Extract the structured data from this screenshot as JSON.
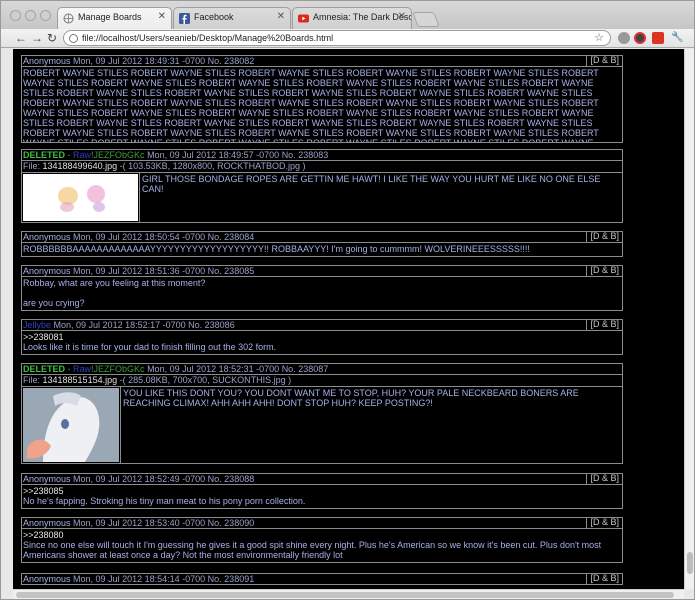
{
  "browser": {
    "tabs": [
      {
        "title": "Manage Boards",
        "icon": "globe-icon"
      },
      {
        "title": "Facebook",
        "icon": "facebook-icon"
      },
      {
        "title": "Amnesia: The Dark Descent",
        "icon": "youtube-icon"
      }
    ],
    "url": "file://localhost/Users/seanieb/Desktop/Manage%20Boards.html",
    "back": "←",
    "forward": "→",
    "reload": "↻",
    "star": "☆",
    "wrench": "🔧"
  },
  "posts": [
    {
      "name": "Anonymous",
      "date": "Mon, 09 Jul 2012 18:49:31 -0700",
      "no": "No. 238082",
      "db": "[D & B]",
      "body": "ROBERT WAYNE STILES ROBERT WAYNE STILES ROBERT WAYNE STILES ROBERT WAYNE STILES ROBERT WAYNE STILES ROBERT WAYNE STILES ROBERT WAYNE STILES ROBERT WAYNE STILES ROBERT WAYNE STILES ROBERT WAYNE STILES ROBERT WAYNE STILES ROBERT WAYNE STILES ROBERT WAYNE STILES ROBERT WAYNE STILES ROBERT WAYNE STILES ROBERT WAYNE STILES ROBERT WAYNE STILES ROBERT WAYNE STILES ROBERT WAYNE STILES ROBERT WAYNE STILES ROBERT WAYNE STILES ROBERT WAYNE STILES ROBERT WAYNE STILES ROBERT WAYNE STILES ROBERT WAYNE STILES ROBERT WAYNE STILES ROBERT WAYNE STILES ROBERT WAYNE STILES ROBERT WAYNE STILES ROBERT WAYNE STILES ROBERT WAYNE STILES ROBERT WAYNE STILES ROBERT WAYNE STILES ROBERT WAYNE STILES ROBERT WAYNE STILES ROBERT WAYNE STILES ROBERT WAYNE STILES ROBERT WAYNE STILES ROBERT WAYNE STILES ROBERT WAYNE STILES ROBERT WAYNE STILES ROBERT WAYNE STILES ROBERT WAYNE STILES ROBERT WAYNE STILES ROBERT WAYNE STILES ROBERT WAYNE STILES ROBERT WAYNE STILES"
    },
    {
      "deleted": "DELETED",
      "sep": " - ",
      "name": "Raw",
      "trip": "!JEZFObGKc",
      "date": "Mon, 09 Jul 2012 18:49:57 -0700",
      "no": "No. 238083",
      "file_label": "File: ",
      "file_name": "134188499640.jpg",
      "file_meta": " -( 103.53KB, 1280x800, ROCKTHATBOD.jpg )",
      "body": "GIRL THOSE BONDAGE ROPES ARE GETTIN ME HAWT! I LIKE THE WAY YOU HURT ME LIKE NO ONE ELSE CAN!"
    },
    {
      "name": "Anonymous",
      "date": "Mon, 09 Jul 2012 18:50:54 -0700",
      "no": "No. 238084",
      "db": "[D & B]",
      "body": "ROBBBBBBAAAAAAAAAAAAAYYYYYYYYYYYYYYYYYYY!! ROBBAAYYY! I'm going to cummmm! WOLVERINEEESSSSS!!!!"
    },
    {
      "name": "Anonymous",
      "date": "Mon, 09 Jul 2012 18:51:36 -0700",
      "no": "No. 238085",
      "db": "[D & B]",
      "body1": "Robbay, what are you feeling at this moment?",
      "body2": "are you crying?"
    },
    {
      "name": "Jellybe",
      "date": "Mon, 09 Jul 2012 18:52:17 -0700",
      "no": "No. 238086",
      "db": "[D & B]",
      "quote": ">>238081",
      "body": "Looks like it is time for your dad to finish filling out the 302 form."
    },
    {
      "deleted": "DELETED",
      "sep": " - ",
      "name": "Raw",
      "trip": "!JEZFObGKc",
      "date": "Mon, 09 Jul 2012 18:52:31 -0700",
      "no": "No. 238087",
      "file_label": "File: ",
      "file_name": "134188515154.jpg",
      "file_meta": " -( 285.08KB, 700x700, SUCKONTHIS.jpg )",
      "body": "YOU LIKE THIS DONT YOU? YOU DONT WANT ME TO STOP, HUH? YOUR PALE NECKBEARD BONERS ARE REACHING CLIMAX! AHH AHH AHH! DONT STOP HUH? KEEP POSTING?!"
    },
    {
      "name": "Anonymous",
      "date": "Mon, 09 Jul 2012 18:52:49 -0700",
      "no": "No. 238088",
      "db": "[D & B]",
      "quote": ">>238085",
      "body": "No he's fapping. Stroking his tiny man meat to his pony porn collection."
    },
    {
      "name": "Anonymous",
      "date": "Mon, 09 Jul 2012 18:53:40 -0700",
      "no": "No. 238090",
      "db": "[D & B]",
      "quote": ">>238080",
      "body": "Since no one else will touch it I'm guessing he gives it a good spit shine every night. Plus he's American so we know it's been cut. Plus don't most Americans shower at least once a day? Not the most environmentally friendly lot"
    },
    {
      "name": "Anonymous",
      "date": "Mon, 09 Jul 2012 18:54:14 -0700",
      "no": "No. 238091",
      "db": "[D & B]"
    }
  ]
}
